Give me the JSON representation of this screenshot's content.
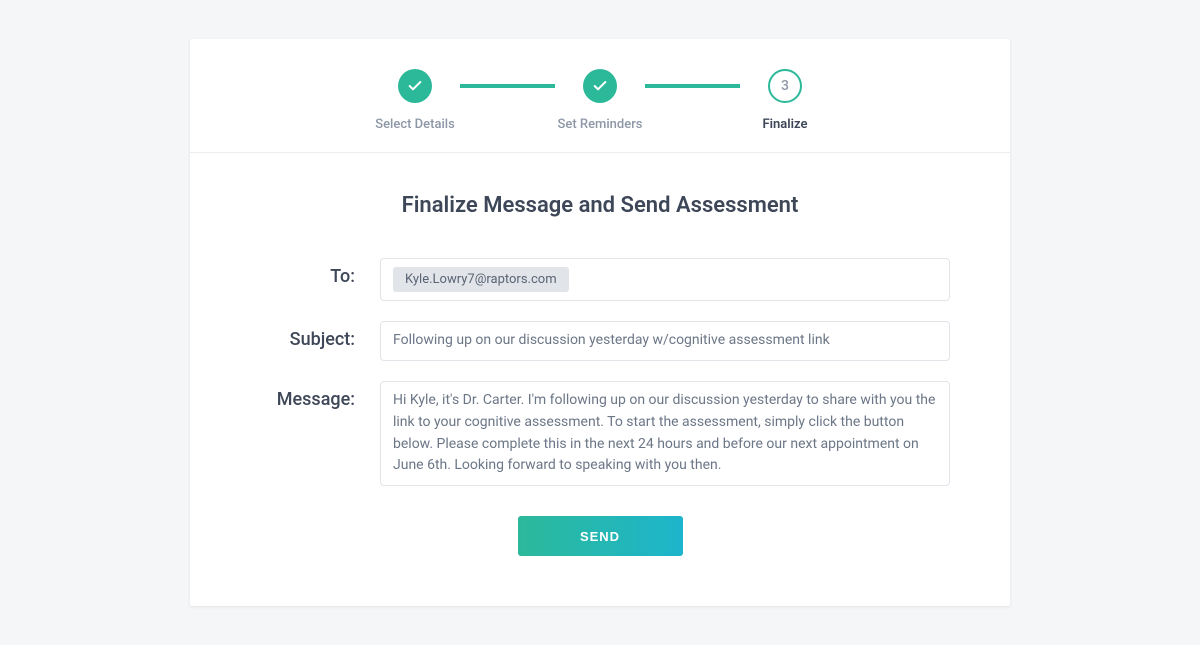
{
  "stepper": {
    "steps": [
      {
        "label": "Select Details"
      },
      {
        "label": "Set Reminders"
      },
      {
        "label": "Finalize",
        "number": "3"
      }
    ]
  },
  "title": "Finalize Message and Send Assessment",
  "form": {
    "toLabel": "To:",
    "toValue": "Kyle.Lowry7@raptors.com",
    "subjectLabel": "Subject:",
    "subjectValue": "Following up on our discussion yesterday w/cognitive assessment link",
    "messageLabel": "Message:",
    "messageValue": "Hi Kyle, it's Dr. Carter. I'm following up on our discussion yesterday to share with you the link to your cognitive assessment. To start the assessment, simply click the button below. Please complete this in the next 24 hours and before our next appointment on June 6th. Looking forward to speaking with you then."
  },
  "sendLabel": "SEND"
}
